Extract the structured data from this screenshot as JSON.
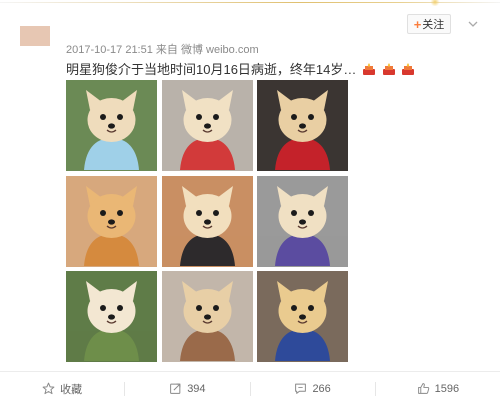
{
  "post": {
    "timestamp": "2017-10-17 21:51",
    "source_prefix": "来自",
    "source": "微博 weibo.com",
    "text": "明星狗俊介于当地时间10月16日病逝，终年14岁",
    "follow_label": "关注"
  },
  "photos": [
    {
      "name": "photo-1",
      "bg": "#6b8a55",
      "fur": "#efdcbc",
      "acc": "#9fd0e8"
    },
    {
      "name": "photo-2",
      "bg": "#b9b2aa",
      "fur": "#f1e1c4",
      "acc": "#d23a3a"
    },
    {
      "name": "photo-3",
      "bg": "#3b3532",
      "fur": "#e9cfa3",
      "acc": "#c4222a"
    },
    {
      "name": "photo-4",
      "bg": "#d7a87d",
      "fur": "#eab775",
      "acc": "#d58a3e"
    },
    {
      "name": "photo-5",
      "bg": "#c98f63",
      "fur": "#f2dfbe",
      "acc": "#2d2a2c"
    },
    {
      "name": "photo-6",
      "bg": "#9a9a9a",
      "fur": "#f0e0c3",
      "acc": "#5b4ca0"
    },
    {
      "name": "photo-7",
      "bg": "#5f7c48",
      "fur": "#f3e7d2",
      "acc": "#6e8e4a"
    },
    {
      "name": "photo-8",
      "bg": "#c2b6aa",
      "fur": "#e8cfa6",
      "acc": "#9a6a4a"
    },
    {
      "name": "photo-9",
      "bg": "#7a6a5c",
      "fur": "#eacb8f",
      "acc": "#2e4a9a"
    }
  ],
  "actions": {
    "favorite_label": "收藏",
    "repost_count": "394",
    "comment_count": "266",
    "like_count": "1596"
  },
  "colors": {
    "accent": "#fa7d3c",
    "meta_text": "#8a8a8a"
  },
  "icons": [
    "star-icon",
    "repost-icon",
    "comment-icon",
    "like-icon",
    "candle-icon",
    "chevron-down-icon"
  ]
}
